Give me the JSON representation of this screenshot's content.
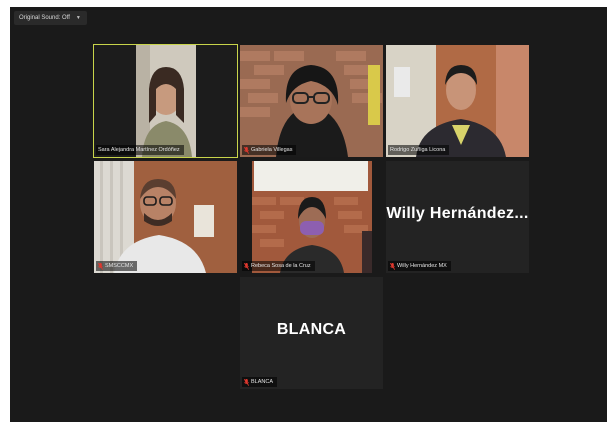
{
  "toolbar": {
    "original_sound_label": "Original Sound: Off",
    "dropdown_icon": "chevron-down-icon"
  },
  "participants": [
    {
      "name": "Sara Alejandra Martínez Ordóñez",
      "muted": false,
      "active_speaker": true,
      "video": true
    },
    {
      "name": "Gabriela Villegas",
      "muted": true,
      "active_speaker": false,
      "video": true
    },
    {
      "name": "Rodrigo Zuñiga Licona",
      "muted": false,
      "active_speaker": false,
      "video": true
    },
    {
      "name": "SMSCCMX",
      "muted": true,
      "active_speaker": false,
      "video": true
    },
    {
      "name": "Rebeca Sosa de la Cruz",
      "muted": true,
      "active_speaker": false,
      "video": true
    },
    {
      "name": "Willy Hernández MX",
      "display_name": "Willy Hernández...",
      "muted": true,
      "active_speaker": false,
      "video": false
    },
    {
      "name": "BLANCA",
      "display_name": "BLANCA",
      "muted": true,
      "active_speaker": false,
      "video": false
    }
  ],
  "colors": {
    "background": "#1a1a1a",
    "active_speaker_border": "#c8d44a",
    "muted_icon": "#e0382e"
  }
}
